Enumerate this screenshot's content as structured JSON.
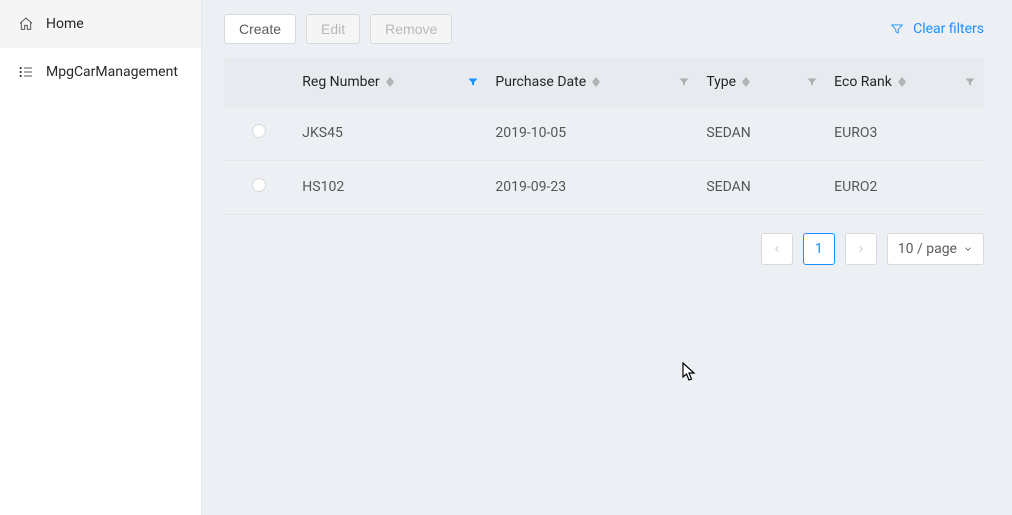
{
  "sidebar": {
    "items": [
      {
        "label": "Home"
      },
      {
        "label": "MpgCarManagement"
      }
    ]
  },
  "toolbar": {
    "create_label": "Create",
    "edit_label": "Edit",
    "remove_label": "Remove",
    "clear_filters_label": "Clear filters"
  },
  "table": {
    "columns": [
      {
        "label": "Reg Number",
        "filter_active": true
      },
      {
        "label": "Purchase Date",
        "filter_active": false
      },
      {
        "label": "Type",
        "filter_active": false
      },
      {
        "label": "Eco Rank",
        "filter_active": false
      }
    ],
    "rows": [
      {
        "reg_number": "JKS45",
        "purchase_date": "2019-10-05",
        "type": "SEDAN",
        "eco_rank": "EURO3"
      },
      {
        "reg_number": "HS102",
        "purchase_date": "2019-09-23",
        "type": "SEDAN",
        "eco_rank": "EURO2"
      }
    ]
  },
  "pagination": {
    "current_page": "1",
    "page_size_label": "10 / page"
  }
}
